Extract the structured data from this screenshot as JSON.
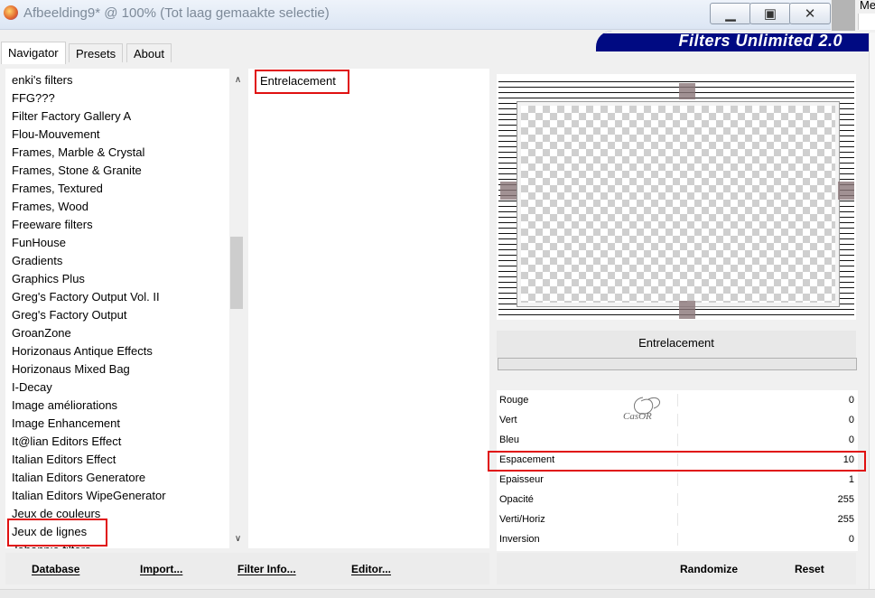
{
  "window": {
    "title": "Afbeelding9* @ 100% (Tot laag gemaakte selectie)",
    "minimize_glyph": "▁",
    "maximize_glyph": "▣",
    "close_glyph": "✕",
    "corner_label": "Me"
  },
  "banner": {
    "title": "Filters Unlimited 2.0"
  },
  "tabs": [
    {
      "label": "Navigator",
      "active": true
    },
    {
      "label": "Presets",
      "active": false
    },
    {
      "label": "About",
      "active": false
    }
  ],
  "categories": {
    "items": [
      "enki's filters",
      "FFG???",
      "Filter Factory Gallery A",
      "Flou-Mouvement",
      "Frames, Marble & Crystal",
      "Frames, Stone & Granite",
      "Frames, Textured",
      "Frames, Wood",
      "Freeware filters",
      "FunHouse",
      "Gradients",
      "Graphics Plus",
      "Greg's Factory Output Vol. II",
      "Greg's Factory Output",
      "GroanZone",
      "Horizonaus Antique Effects",
      "Horizonaus Mixed Bag",
      "I-Decay",
      "Image améliorations",
      "Image Enhancement",
      "It@lian Editors Effect",
      "Italian Editors Effect",
      "Italian Editors Generatore",
      "Italian Editors WipeGenerator",
      "Jeux de couleurs",
      "Jeux de lignes",
      "Johannie filters"
    ],
    "selected": "Jeux de lignes",
    "scroll_up_glyph": "∧",
    "scroll_down_glyph": "∨"
  },
  "filters": {
    "items": [
      "Entrelacement"
    ],
    "selected": "Entrelacement"
  },
  "preview": {
    "filter_name": "Entrelacement"
  },
  "parameters": [
    {
      "label": "Rouge",
      "value": "0"
    },
    {
      "label": "Vert",
      "value": "0"
    },
    {
      "label": "Bleu",
      "value": "0"
    },
    {
      "label": "Espacement",
      "value": "10"
    },
    {
      "label": "Epaisseur",
      "value": "1"
    },
    {
      "label": "Opacité",
      "value": "255"
    },
    {
      "label": "Verti/Horiz",
      "value": "255"
    },
    {
      "label": "Inversion",
      "value": "0"
    }
  ],
  "highlighted_parameter": "Espacement",
  "watermark": "CasOR",
  "buttons": {
    "database": "Database",
    "import": "Import...",
    "filter_info": "Filter Info...",
    "editor": "Editor...",
    "randomize": "Randomize",
    "reset": "Reset"
  }
}
